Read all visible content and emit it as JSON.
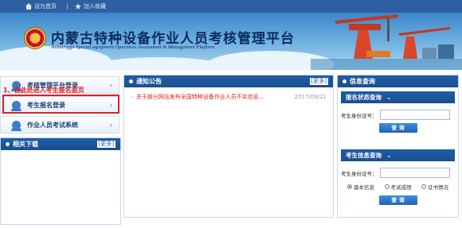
{
  "topbar": {
    "homepage_label": "设为首页",
    "favorite_label": "加入收藏"
  },
  "banner": {
    "title": "内蒙古特种设备作业人员考核管理平台",
    "subtitle": "Neimenggu Special equipment Operators Assessment & Management Platform"
  },
  "menu": {
    "items": [
      {
        "label": "考核管理平台登录"
      },
      {
        "label": "考生报名登录"
      },
      {
        "label": "作业人员考试系统"
      }
    ],
    "chevron": "›"
  },
  "annotation": "1、首此处进入考生报名面页",
  "downloads": {
    "title": "相关下载",
    "more": "[更多]"
  },
  "notice": {
    "title": "通知公告",
    "more": "[更多]",
    "items": [
      {
        "text": "关于部分网站发布全国特种设备作业人员不实信息...",
        "date": "2017/09/21"
      }
    ]
  },
  "info_query": {
    "title": "信息查询",
    "status_query": {
      "title": "报名状态查询",
      "id_label": "考生身份证号：",
      "button": "查  询"
    },
    "info_search": {
      "title": "考生信息查询",
      "id_label": "考生身份证号：",
      "options": [
        "基本信息",
        "考试成绩",
        "证书情况"
      ],
      "selected": "基本信息",
      "button": "查  询"
    }
  },
  "colors": {
    "header_blue": "#1f5ea8",
    "highlight_red": "#e02020"
  }
}
